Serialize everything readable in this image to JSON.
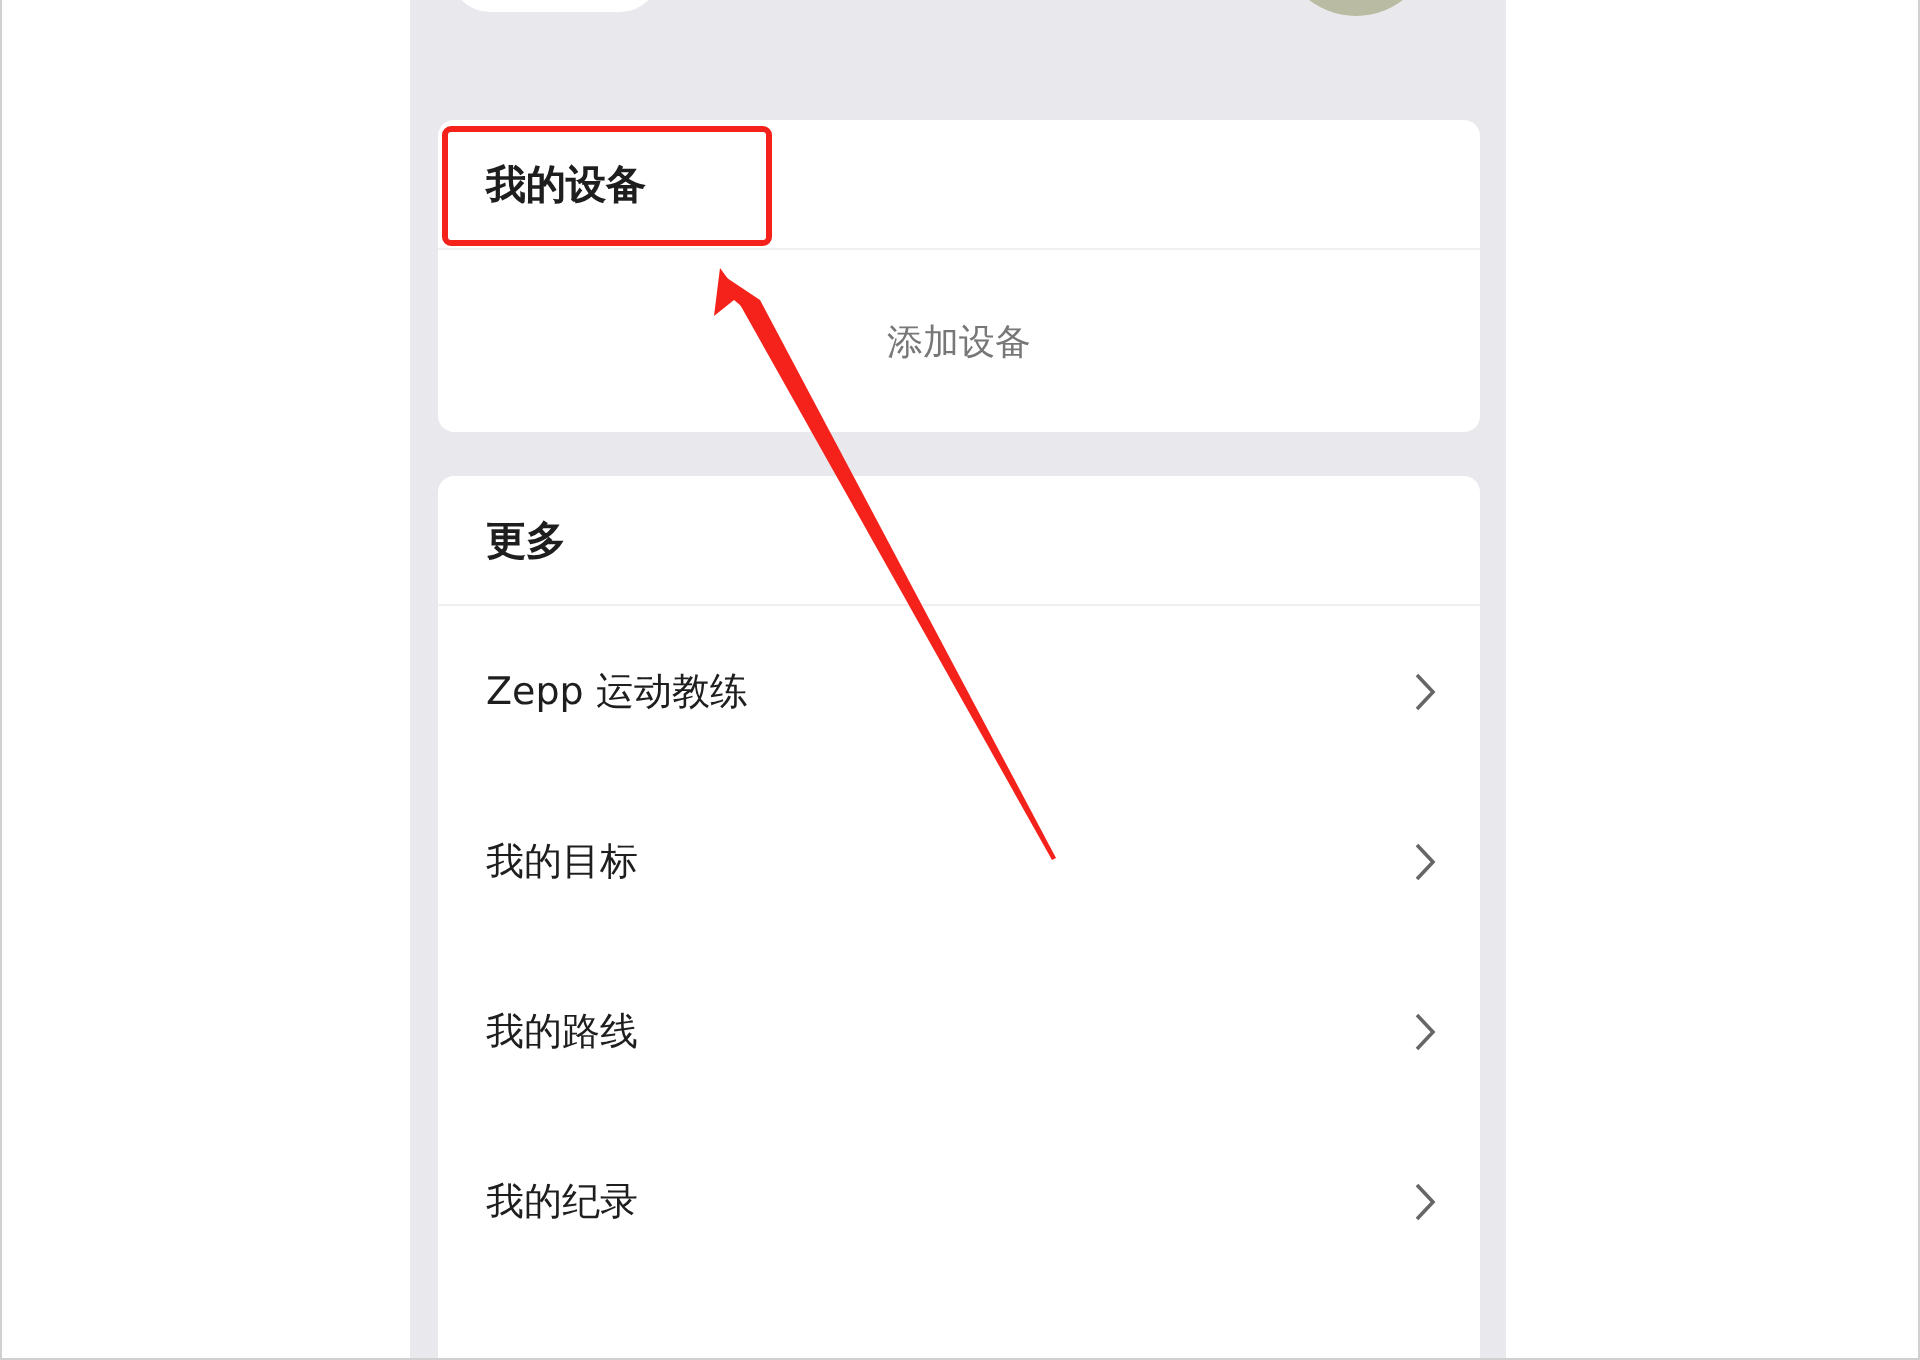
{
  "devices": {
    "title": "我的设备",
    "add_label": "添加设备"
  },
  "more": {
    "title": "更多",
    "items": [
      {
        "label": "Zepp 运动教练"
      },
      {
        "label": "我的目标"
      },
      {
        "label": "我的路线"
      },
      {
        "label": "我的纪录"
      }
    ]
  }
}
